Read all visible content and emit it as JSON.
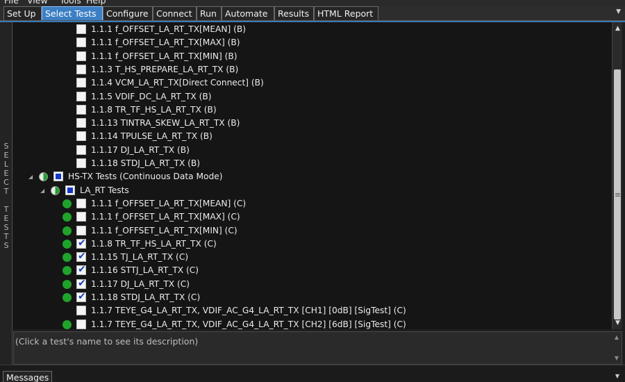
{
  "menu": [
    "File",
    "View",
    "Tools",
    "Help"
  ],
  "tabs": [
    {
      "label": "Set Up",
      "active": false
    },
    {
      "label": "Select Tests",
      "active": true
    },
    {
      "label": "Configure",
      "active": false
    },
    {
      "label": "Connect",
      "active": false
    },
    {
      "label": "Run",
      "active": false
    },
    {
      "label": "Automate",
      "active": false
    },
    {
      "label": "Results",
      "active": false
    },
    {
      "label": "HTML Report",
      "active": false
    }
  ],
  "side_label": "SELECT TESTS",
  "tree": {
    "rows": [
      {
        "label": "1.1.1 f_OFFSET_LA_RT_TX[MEAN] (B)",
        "status": "none",
        "checked": false
      },
      {
        "label": "1.1.1 f_OFFSET_LA_RT_TX[MAX] (B)",
        "status": "none",
        "checked": false
      },
      {
        "label": "1.1.1 f_OFFSET_LA_RT_TX[MIN] (B)",
        "status": "none",
        "checked": false
      },
      {
        "label": "1.1.3 T_HS_PREPARE_LA_RT_TX (B)",
        "status": "none",
        "checked": false
      },
      {
        "label": "1.1.4 VCM_LA_RT_TX[Direct Connect] (B)",
        "status": "none",
        "checked": false
      },
      {
        "label": "1.1.5 VDIF_DC_LA_RT_TX (B)",
        "status": "none",
        "checked": false
      },
      {
        "label": "1.1.8 TR_TF_HS_LA_RT_TX (B)",
        "status": "none",
        "checked": false
      },
      {
        "label": "1.1.13 TINTRA_SKEW_LA_RT_TX (B)",
        "status": "none",
        "checked": false
      },
      {
        "label": "1.1.14 TPULSE_LA_RT_TX (B)",
        "status": "none",
        "checked": false
      },
      {
        "label": "1.1.17 DJ_LA_RT_TX (B)",
        "status": "none",
        "checked": false
      },
      {
        "label": "1.1.18 STDJ_LA_RT_TX (B)",
        "status": "none",
        "checked": false
      }
    ],
    "group": {
      "label": "HS-TX Tests (Continuous Data Mode)"
    },
    "subgroup": {
      "label": "LA_RT Tests"
    },
    "sub_rows": [
      {
        "label": "1.1.1 f_OFFSET_LA_RT_TX[MEAN] (C)",
        "status": "pass",
        "checked": false
      },
      {
        "label": "1.1.1 f_OFFSET_LA_RT_TX[MAX] (C)",
        "status": "pass",
        "checked": false
      },
      {
        "label": "1.1.1 f_OFFSET_LA_RT_TX[MIN] (C)",
        "status": "pass",
        "checked": false
      },
      {
        "label": "1.1.8 TR_TF_HS_LA_RT_TX (C)",
        "status": "pass",
        "checked": true
      },
      {
        "label": "1.1.15 TJ_LA_RT_TX (C)",
        "status": "pass",
        "checked": true
      },
      {
        "label": "1.1.16 STTJ_LA_RT_TX (C)",
        "status": "pass",
        "checked": true
      },
      {
        "label": "1.1.17 DJ_LA_RT_TX (C)",
        "status": "pass",
        "checked": true
      },
      {
        "label": "1.1.18 STDJ_LA_RT_TX (C)",
        "status": "pass",
        "checked": true
      },
      {
        "label": "1.1.7 TEYE_G4_LA_RT_TX, VDIF_AC_G4_LA_RT_TX [CH1] [0dB] [SigTest] (C)",
        "status": "none",
        "checked": false
      },
      {
        "label": "1.1.7 TEYE_G4_LA_RT_TX, VDIF_AC_G4_LA_RT_TX [CH2] [6dB] [SigTest] (C)",
        "status": "pass",
        "checked": false
      }
    ]
  },
  "description": {
    "placeholder": "(Click a test's name to see its description)"
  },
  "bottom": {
    "messages_label": "Messages"
  },
  "icons": {
    "pass_status": "green-dot-icon",
    "partial_status": "half-circle-icon",
    "check": "checkmark-icon",
    "tab_overflow": "chevron-down-icon",
    "scroll_up": "chevron-up-icon",
    "scroll_down": "chevron-down-icon"
  },
  "colors": {
    "accent": "#3c7fc4",
    "pass": "#1fa32b",
    "check": "#1a3fb8"
  }
}
